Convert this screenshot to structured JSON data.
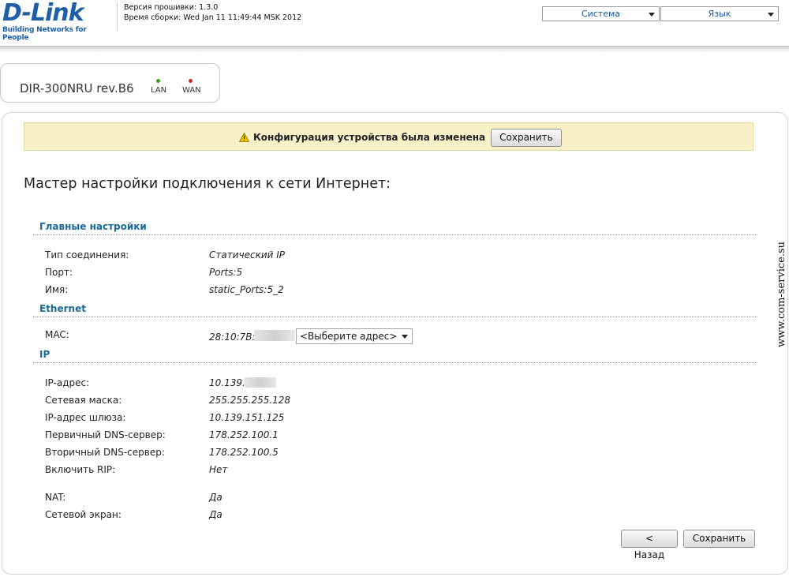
{
  "header": {
    "logo_text": "D-Link",
    "logo_tagline": "Building Networks for People",
    "firmware_label": "Версия прошивки:",
    "firmware_value": "1.3.0",
    "build_label": "Время сборки:",
    "build_value": "Wed Jan 11 11:49:44 MSK 2012",
    "system_menu": "Система",
    "language_menu": "Язык"
  },
  "device": {
    "name": "DIR-300NRU rev.B6",
    "lan_label": "LAN",
    "wan_label": "WAN",
    "lan_color": "#3c9a2a",
    "wan_color": "#d42a1a"
  },
  "notice": {
    "icon": "warning-icon",
    "text": "Конфигурация устройства была изменена",
    "save_label": "Сохранить"
  },
  "wizard": {
    "title": "Мастер настройки подключения к сети Интернет:"
  },
  "sections": {
    "main": {
      "title": "Главные настройки",
      "rows": [
        {
          "label": "Тип соединения:",
          "value": "Статический IP"
        },
        {
          "label": "Порт:",
          "value": "Ports:5"
        },
        {
          "label": "Имя:",
          "value": "static_Ports:5_2"
        }
      ]
    },
    "ethernet": {
      "title": "Ethernet",
      "mac_label": "MAC:",
      "mac_value": "28:10:7B:",
      "mac_select": "<Выберите адрес>"
    },
    "ip": {
      "title": "IP",
      "rows": [
        {
          "label": "IP-адрес:",
          "value": "10.139."
        },
        {
          "label": "Сетевая маска:",
          "value": "255.255.255.128"
        },
        {
          "label": "IP-адрес шлюза:",
          "value": "10.139.151.125"
        },
        {
          "label": "Первичный DNS-сервер:",
          "value": "178.252.100.1"
        },
        {
          "label": "Вторичный DNS-сервер:",
          "value": "178.252.100.5"
        },
        {
          "label": "Включить RIP:",
          "value": "Нет"
        },
        {
          "label": "NAT:",
          "value": "Да"
        },
        {
          "label": "Сетевой экран:",
          "value": "Да"
        }
      ]
    }
  },
  "footer": {
    "back_label": "< Назад",
    "save_label": "Сохранить"
  },
  "watermark": "www.com-service.su"
}
